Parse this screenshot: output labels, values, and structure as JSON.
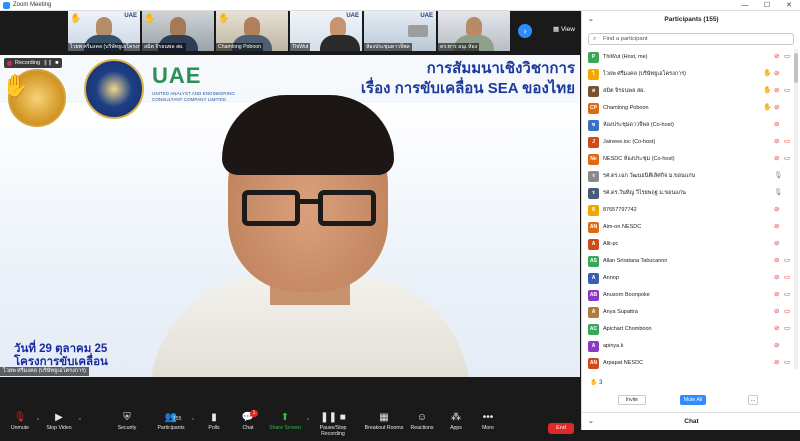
{
  "window": {
    "title": "Zoom Meeting",
    "controls": [
      "—",
      "☐",
      "✕"
    ]
  },
  "strip": {
    "thumbs": [
      {
        "name": "ไวยพ ศรีมงคล (บริษัทยูเอโครงการ)",
        "hand": true
      },
      {
        "name": "สมิต จิรธนพล สผ.",
        "hand": true
      },
      {
        "name": "Chamlong Poboon",
        "hand": true
      },
      {
        "name": "ThiWut",
        "hand": false
      },
      {
        "name": "ห้องประชุมดาวจีพล",
        "hand": false
      },
      {
        "name": "ดร.ทาร อนุเ ห้อง",
        "hand": false
      }
    ],
    "next_icon": "chevron-right-icon",
    "view_label": "View"
  },
  "main": {
    "recording_label": "Recording",
    "slide_title_line1": "การสัมมนาเชิงวิชาการ",
    "slide_title_line2": "เรื่อง การขับเคลื่อน SEA ของไทย",
    "uae_logo": "UAE",
    "uae_sub": "UNITED ANALYST AND ENGINEERING CONSULTANT COMPANY LIMITED",
    "footer_line1": "วันที่ 29 ตุลาคม 25",
    "footer_line2": "โครงการขับเคลื่อน",
    "speaker_name": "ไวยพ ศรีมงคล (บริษัทยูเอโครงการ)"
  },
  "toolbar": {
    "unmute": "Unmute",
    "stop_video": "Stop Video",
    "security": "Security",
    "participants": "Participants",
    "participants_count": "155",
    "polls": "Polls",
    "chat": "Chat",
    "chat_badge": "1",
    "share_screen": "Share Screen",
    "pause_recording": "Pause/Stop Recording",
    "breakout": "Breakout Rooms",
    "reactions": "Reactions",
    "apps": "Apps",
    "more": "More",
    "end": "End"
  },
  "panel": {
    "title": "Participants (155)",
    "search_placeholder": "Find a participant",
    "participants": [
      {
        "initials": "P",
        "color": "#3aa657",
        "name": "ThiWut (Host, me)",
        "hand": false,
        "video_off": true,
        "mic": "muted"
      },
      {
        "initials": "ไ",
        "color": "#f0a800",
        "name": "ไวยพ ศรีมงคล (บริษัทยูเอโครงการ)",
        "hand": true,
        "video_off": false,
        "mic": "muted"
      },
      {
        "initials": "ส",
        "color": "#7a5230",
        "name": "สมิต จิรธนพล สผ.",
        "hand": true,
        "video_off": true,
        "mic": "muted"
      },
      {
        "initials": "CP",
        "color": "#e06a10",
        "name": "Chamlong Poboon",
        "hand": true,
        "video_off": false,
        "mic": "muted"
      },
      {
        "initials": "ห",
        "color": "#3a6fc2",
        "name": "ห้องประชุมดาวจีพล (Co-host)",
        "hand": false,
        "video_off": false,
        "mic": "muted"
      },
      {
        "initials": "J",
        "color": "#d04a1a",
        "name": "Jaineee.ioc (Co-host)",
        "hand": false,
        "video_off": true,
        "mic": "muted"
      },
      {
        "initials": "Ne",
        "color": "#e06a10",
        "name": "NESDC ห้องประชุม (Co-host)",
        "hand": false,
        "video_off": true,
        "mic": "muted"
      },
      {
        "initials": "ร",
        "color": "#8a8a8a",
        "name": "รศ.ดร.เฉก วัฒนธนิตีเลิศกิจ ม.ขอนแก่น",
        "hand": false,
        "video_off": false,
        "mic": "on"
      },
      {
        "initials": "ร",
        "color": "#4a5a7a",
        "name": "รศ.ดร.วันทิญ วิไรยพฤฐ ม.ขอนแก่น",
        "hand": false,
        "video_off": false,
        "mic": "on"
      },
      {
        "initials": "8",
        "color": "#f0a800",
        "name": "87657797742",
        "hand": false,
        "video_off": false,
        "mic": "muted"
      },
      {
        "initials": "AN",
        "color": "#e06a10",
        "name": "Aim-on NESDC",
        "hand": false,
        "video_off": false,
        "mic": "muted"
      },
      {
        "initials": "A",
        "color": "#d04a1a",
        "name": "Alit-pc",
        "hand": false,
        "video_off": false,
        "mic": "muted"
      },
      {
        "initials": "AS",
        "color": "#3aa657",
        "name": "Allan Sriratana Tabucanon",
        "hand": false,
        "video_off": true,
        "mic": "muted"
      },
      {
        "initials": "A",
        "color": "#3a5fb0",
        "name": "Annop",
        "hand": false,
        "video_off": true,
        "mic": "muted"
      },
      {
        "initials": "AB",
        "color": "#8a3ac2",
        "name": "Anusorn Boonpoke",
        "hand": false,
        "video_off": true,
        "mic": "muted"
      },
      {
        "initials": "A",
        "color": "#b07a40",
        "name": "Anya Supattra",
        "hand": false,
        "video_off": true,
        "mic": "muted"
      },
      {
        "initials": "AC",
        "color": "#3aa657",
        "name": "Apichart Chomboon",
        "hand": false,
        "video_off": true,
        "mic": "muted"
      },
      {
        "initials": "A",
        "color": "#8a3ac2",
        "name": "apinya.k",
        "hand": false,
        "video_off": false,
        "mic": "muted"
      },
      {
        "initials": "AN",
        "color": "#d04a1a",
        "name": "Arpapat NESDC",
        "hand": false,
        "video_off": true,
        "mic": "muted"
      }
    ],
    "hand_count": "3",
    "invite": "Invite",
    "mute_all": "Mute All",
    "more": "...",
    "chat_title": "Chat"
  }
}
